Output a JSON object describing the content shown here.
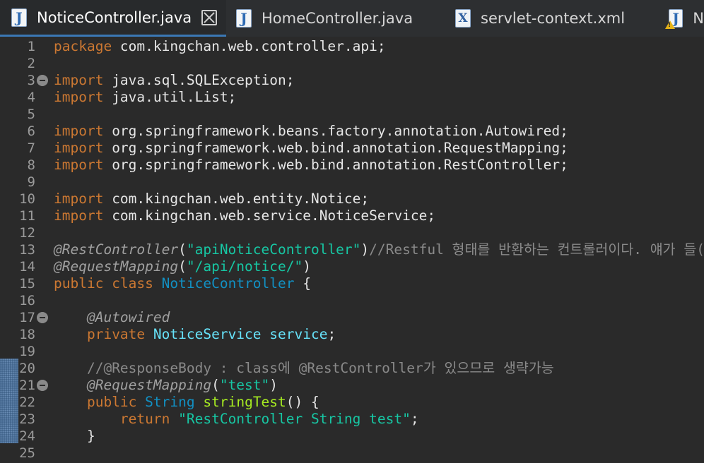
{
  "tabs": [
    {
      "label": "NoticeController.java",
      "icon": "java-file-icon",
      "active": true
    },
    {
      "label": "HomeController.java",
      "icon": "java-file-icon",
      "active": false
    },
    {
      "label": "servlet-context.xml",
      "icon": "xml-file-icon",
      "active": false
    },
    {
      "label": "N",
      "icon": "java-file-warning-icon",
      "active": false
    }
  ],
  "java_icon_letter": "J",
  "xml_icon_letter": "X",
  "warning_mark": "!",
  "colors": {
    "keyword": "#cc7832",
    "annotation": "#a0a0a0",
    "string": "#17c6a3",
    "comment": "#8a8a8a",
    "type": "#1290c3",
    "field": "#66e1f8",
    "method": "#a7ec21",
    "active_tab_underline": "#3b78b5"
  },
  "lines": [
    {
      "n": "1",
      "fold": false,
      "tokens": [
        {
          "t": "package",
          "c": "kw"
        },
        {
          "t": " com.kingchan.web.controller.api;"
        }
      ]
    },
    {
      "n": "2",
      "fold": false,
      "tokens": []
    },
    {
      "n": "3",
      "fold": true,
      "tokens": [
        {
          "t": "import",
          "c": "kw"
        },
        {
          "t": " java.sql.SQLException;"
        }
      ]
    },
    {
      "n": "4",
      "fold": false,
      "tokens": [
        {
          "t": "import",
          "c": "kw"
        },
        {
          "t": " java.util.List;"
        }
      ]
    },
    {
      "n": "5",
      "fold": false,
      "tokens": []
    },
    {
      "n": "6",
      "fold": false,
      "tokens": [
        {
          "t": "import",
          "c": "kw"
        },
        {
          "t": " org.springframework.beans.factory.annotation.Autowired;"
        }
      ]
    },
    {
      "n": "7",
      "fold": false,
      "tokens": [
        {
          "t": "import",
          "c": "kw"
        },
        {
          "t": " org.springframework.web.bind.annotation.RequestMapping;"
        }
      ]
    },
    {
      "n": "8",
      "fold": false,
      "tokens": [
        {
          "t": "import",
          "c": "kw"
        },
        {
          "t": " org.springframework.web.bind.annotation.RestController;"
        }
      ]
    },
    {
      "n": "9",
      "fold": false,
      "tokens": []
    },
    {
      "n": "10",
      "fold": false,
      "tokens": [
        {
          "t": "import",
          "c": "kw"
        },
        {
          "t": " com.kingchan.web.entity.Notice;"
        }
      ]
    },
    {
      "n": "11",
      "fold": false,
      "tokens": [
        {
          "t": "import",
          "c": "kw"
        },
        {
          "t": " com.kingchan.web.service.NoticeService;"
        }
      ]
    },
    {
      "n": "12",
      "fold": false,
      "tokens": []
    },
    {
      "n": "13",
      "fold": false,
      "tokens": [
        {
          "t": "@RestController",
          "c": "ann"
        },
        {
          "t": "("
        },
        {
          "t": "\"apiNoticeController\"",
          "c": "str"
        },
        {
          "t": ")"
        },
        {
          "t": "//Restful 형태를 반환하는 컨트롤러이다. 얘가 들(",
          "c": "cmt"
        }
      ]
    },
    {
      "n": "14",
      "fold": false,
      "tokens": [
        {
          "t": "@RequestMapping",
          "c": "ann"
        },
        {
          "t": "("
        },
        {
          "t": "\"/api/notice/\"",
          "c": "str"
        },
        {
          "t": ")"
        }
      ]
    },
    {
      "n": "15",
      "fold": false,
      "tokens": [
        {
          "t": "public",
          "c": "kw"
        },
        {
          "t": " "
        },
        {
          "t": "class",
          "c": "kw"
        },
        {
          "t": " "
        },
        {
          "t": "NoticeController",
          "c": "cls"
        },
        {
          "t": " {"
        }
      ]
    },
    {
      "n": "16",
      "fold": false,
      "tokens": []
    },
    {
      "n": "17",
      "fold": true,
      "tokens": [
        {
          "t": "    "
        },
        {
          "t": "@Autowired",
          "c": "ann"
        }
      ]
    },
    {
      "n": "18",
      "fold": false,
      "tokens": [
        {
          "t": "    "
        },
        {
          "t": "private",
          "c": "kw"
        },
        {
          "t": " "
        },
        {
          "t": "NoticeService",
          "c": "fld"
        },
        {
          "t": " "
        },
        {
          "t": "service",
          "c": "fld"
        },
        {
          "t": ";"
        }
      ]
    },
    {
      "n": "19",
      "fold": false,
      "tokens": []
    },
    {
      "n": "20",
      "fold": false,
      "tokens": [
        {
          "t": "    "
        },
        {
          "t": "//@ResponseBody : class에 @RestController가 있으므로 생략가능",
          "c": "cmt"
        }
      ]
    },
    {
      "n": "21",
      "fold": true,
      "tokens": [
        {
          "t": "    "
        },
        {
          "t": "@RequestMapping",
          "c": "ann"
        },
        {
          "t": "("
        },
        {
          "t": "\"test\"",
          "c": "str"
        },
        {
          "t": ")"
        }
      ]
    },
    {
      "n": "22",
      "fold": false,
      "tokens": [
        {
          "t": "    "
        },
        {
          "t": "public",
          "c": "kw"
        },
        {
          "t": " "
        },
        {
          "t": "String",
          "c": "type"
        },
        {
          "t": " "
        },
        {
          "t": "stringTest",
          "c": "mth"
        },
        {
          "t": "() {"
        }
      ]
    },
    {
      "n": "23",
      "fold": false,
      "tokens": [
        {
          "t": "        "
        },
        {
          "t": "return",
          "c": "kw"
        },
        {
          "t": " "
        },
        {
          "t": "\"RestController String test\"",
          "c": "str"
        },
        {
          "t": ";"
        }
      ]
    },
    {
      "n": "24",
      "fold": false,
      "tokens": [
        {
          "t": "    }"
        }
      ]
    },
    {
      "n": "25",
      "fold": false,
      "tokens": []
    }
  ]
}
